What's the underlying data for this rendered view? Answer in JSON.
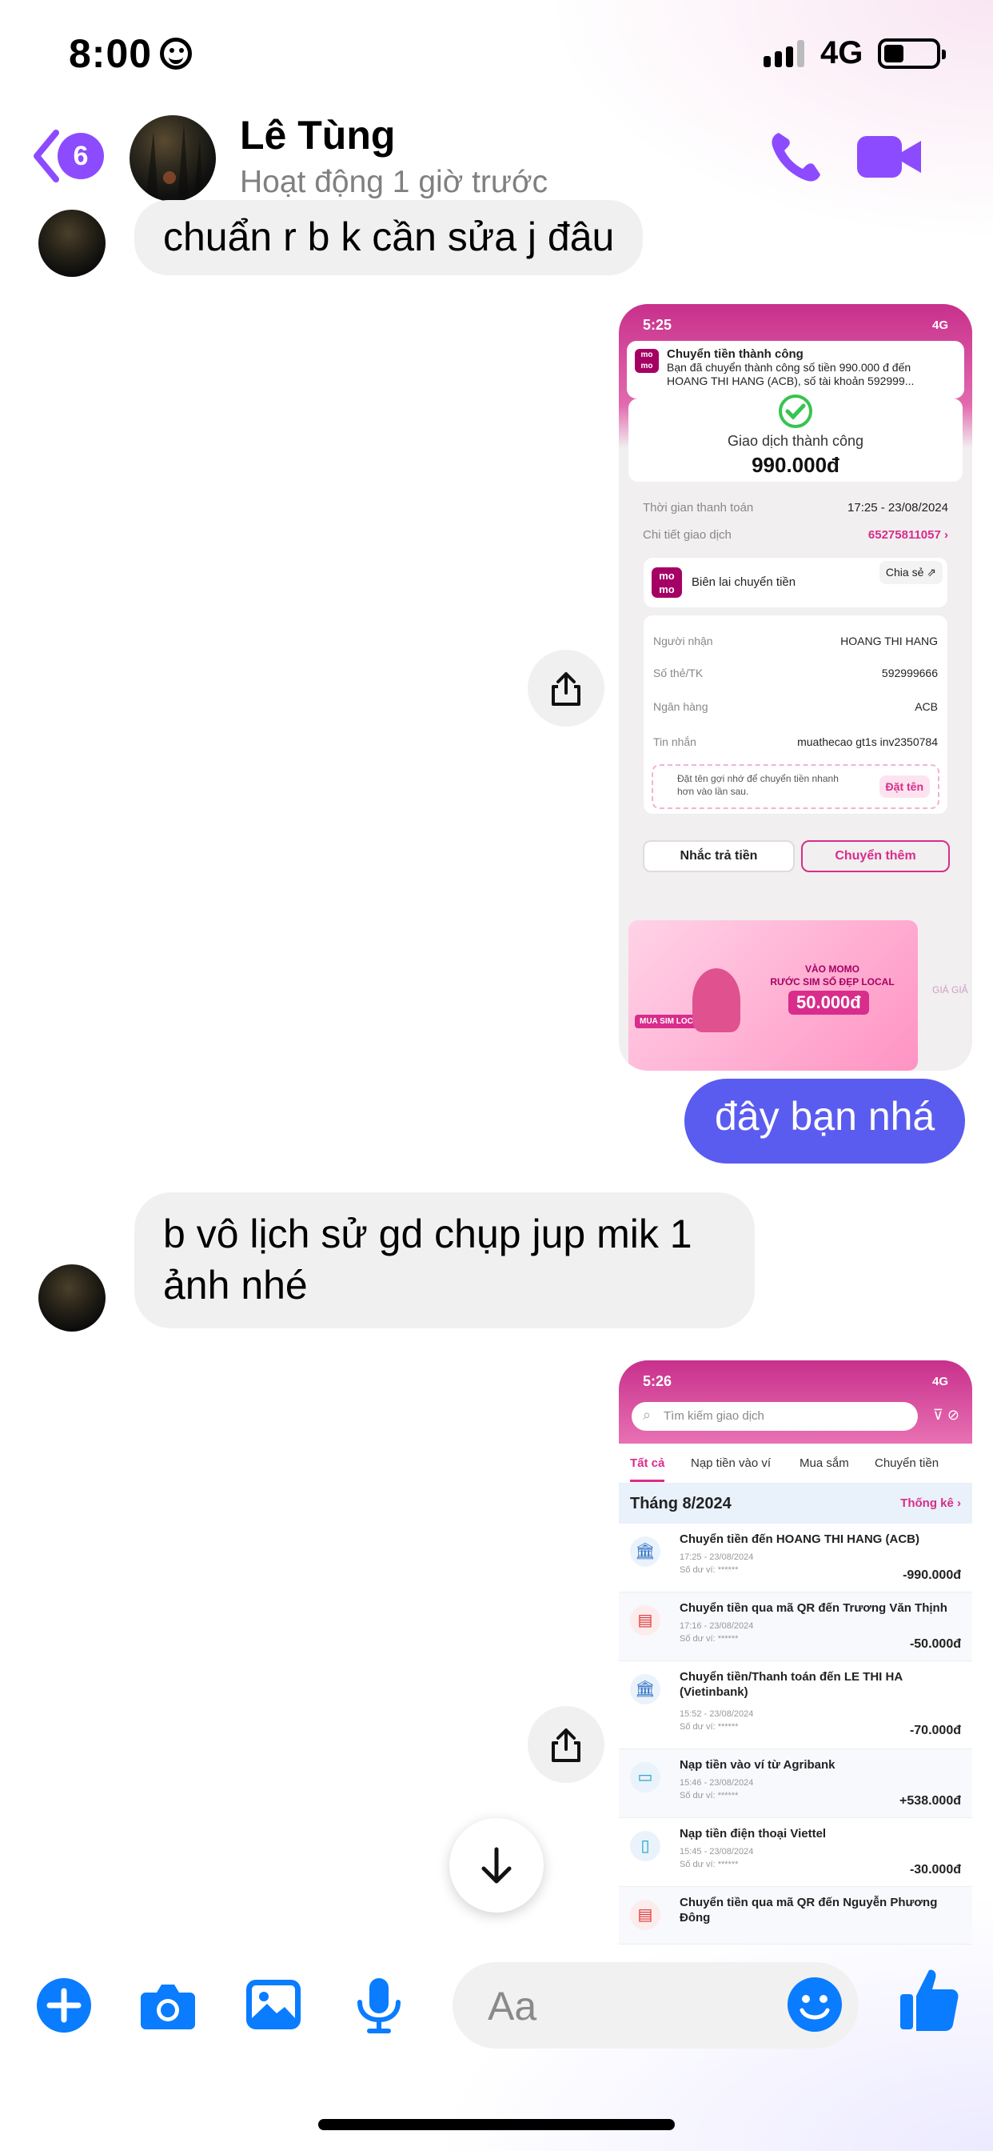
{
  "status_bar": {
    "time": "8:00",
    "network": "4G"
  },
  "header": {
    "back_badge": "6",
    "contact_name": "Lê Tùng",
    "contact_status": "Hoạt động 1 giờ trước"
  },
  "messages": {
    "m1": "chuẩn r b  k cần sửa j đâu",
    "m2": "đây bạn nhá",
    "m3_line1": "b vô lịch sử gd chụp jup mik 1",
    "m3_line2": "ảnh nhé"
  },
  "receipt": {
    "time": "5:25",
    "network": "4G",
    "notif_title": "Chuyển tiền thành công",
    "notif_body1": "Bạn đã chuyển thành công số tiền 990.000 đ đến",
    "notif_body2": "HOANG THI HANG (ACB), số tài khoản 592999...",
    "status": "Giao dịch thành công",
    "amount": "990.000đ",
    "paid_time_label": "Thời gian thanh toán",
    "paid_time": "17:25 - 23/08/2024",
    "detail_label": "Chi tiết giao dịch",
    "detail_value": "65275811057 ›",
    "logo_text": "mo mo",
    "receipt_label": "Biên lai chuyển tiền",
    "share_label": "Chia sẻ",
    "recipient_label": "Người nhận",
    "recipient": "HOANG THI HANG",
    "account_label": "Số thẻ/TK",
    "account": "592999666",
    "bank_label": "Ngân hàng",
    "bank": "ACB",
    "message_label": "Tin nhắn",
    "message": "muathecao gt1s inv2350784",
    "hint": "Đặt tên gợi nhớ để chuyển tiền nhanh hơn vào lần sau.",
    "name_button": "Đặt tên",
    "remind_button": "Nhắc trả tiền",
    "more_button": "Chuyển thêm",
    "promo_line1": "VÀO MOMO",
    "promo_line2": "RƯỚC SIM SỐ ĐẸP LOCAL",
    "promo_price": "50.000đ",
    "promo_tag": "MUA SIM LOCAL",
    "promo_side": "GIÁ GIẢ"
  },
  "history": {
    "time": "5:26",
    "network": "4G",
    "search_placeholder": "Tìm kiếm giao dịch",
    "tabs": [
      "Tất cả",
      "Nạp tiền vào ví",
      "Mua sắm",
      "Chuyển tiền"
    ],
    "month": "Tháng 8/2024",
    "stats": "Thống kê ›",
    "items": [
      {
        "title": "Chuyển tiền đến HOANG THI HANG (ACB)",
        "date": "17:25 - 23/08/2024",
        "balance": "Số dư ví: ******",
        "amount": "-990.000đ"
      },
      {
        "title": "Chuyển tiền qua mã QR đến Trương Văn Thịnh",
        "date": "17:16 - 23/08/2024",
        "balance": "Số dư ví: ******",
        "amount": "-50.000đ"
      },
      {
        "title": "Chuyển tiền/Thanh toán đến LE THI HA (Vietinbank)",
        "date": "15:52 - 23/08/2024",
        "balance": "Số dư ví: ******",
        "amount": "-70.000đ"
      },
      {
        "title": "Nạp tiền vào ví từ Agribank",
        "date": "15:46 - 23/08/2024",
        "balance": "Số dư ví: ******",
        "amount": "+538.000đ"
      },
      {
        "title": "Nạp tiền điện thoại Viettel",
        "date": "15:45 - 23/08/2024",
        "balance": "Số dư ví: ******",
        "amount": "-30.000đ"
      },
      {
        "title": "Chuyển tiền qua mã QR đến Nguyễn Phương Đông",
        "date": "",
        "balance": "",
        "amount": ""
      }
    ]
  },
  "composer": {
    "placeholder": "Aa"
  },
  "colors": {
    "accent": "#8d4bff",
    "messenger_blue": "#0a7cff",
    "outgoing_bubble": "#5a5cf0",
    "momo_pink": "#d82d8b"
  }
}
